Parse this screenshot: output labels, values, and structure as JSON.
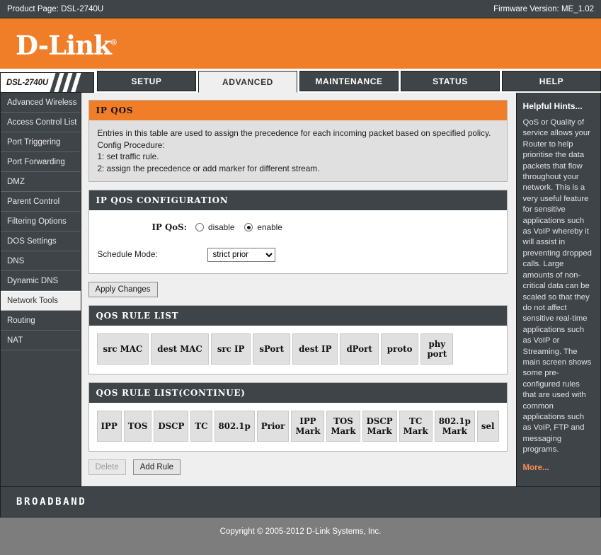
{
  "topbar": {
    "product_page": "Product Page: DSL-2740U",
    "firmware": "Firmware Version: ME_1.02"
  },
  "brand": {
    "logo": "D-Link",
    "registered": "®"
  },
  "model_tab": {
    "label": "DSL-2740U"
  },
  "tabs": [
    {
      "label": "SETUP",
      "active": false
    },
    {
      "label": "ADVANCED",
      "active": true
    },
    {
      "label": "MAINTENANCE",
      "active": false
    },
    {
      "label": "STATUS",
      "active": false
    },
    {
      "label": "HELP",
      "active": false
    }
  ],
  "sidebar": {
    "items": [
      {
        "label": "Advanced Wireless",
        "active": false
      },
      {
        "label": "Access Control List",
        "active": false
      },
      {
        "label": "Port Triggering",
        "active": false
      },
      {
        "label": "Port Forwarding",
        "active": false
      },
      {
        "label": "DMZ",
        "active": false
      },
      {
        "label": "Parent Control",
        "active": false
      },
      {
        "label": "Filtering Options",
        "active": false
      },
      {
        "label": "DOS Settings",
        "active": false
      },
      {
        "label": "DNS",
        "active": false
      },
      {
        "label": "Dynamic DNS",
        "active": false
      },
      {
        "label": "Network Tools",
        "active": true
      },
      {
        "label": "Routing",
        "active": false
      },
      {
        "label": "NAT",
        "active": false
      }
    ]
  },
  "ip_qos": {
    "title": "IP QOS",
    "description_lines": [
      "Entries in this table are used to assign the precedence for each incoming packet based on specified policy.",
      "Config Procedure:",
      "1: set traffic rule.",
      "2: assign the precedence or add marker for different stream."
    ]
  },
  "config": {
    "title": "IP QOS CONFIGURATION",
    "ipqos_label": "IP QoS:",
    "disable_label": "disable",
    "enable_label": "enable",
    "selected": "enable",
    "schedule_label": "Schedule Mode:",
    "schedule_value": "strict prior",
    "schedule_options": [
      "strict prior"
    ],
    "apply_label": "Apply Changes"
  },
  "rule_list": {
    "title": "QOS RULE LIST",
    "headers": [
      "src MAC",
      "dest MAC",
      "src IP",
      "sPort",
      "dest IP",
      "dPort",
      "proto",
      "phy\nport"
    ],
    "rows": []
  },
  "rule_list_continue": {
    "title": "QOS RULE LIST(CONTINUE)",
    "headers": [
      "IPP",
      "TOS",
      "DSCP",
      "TC",
      "802.1p",
      "Prior",
      "IPP\nMark",
      "TOS\nMark",
      "DSCP\nMark",
      "TC\nMark",
      "802.1p\nMark",
      "sel"
    ],
    "rows": []
  },
  "actions": {
    "delete_label": "Delete",
    "delete_disabled": true,
    "add_rule_label": "Add Rule"
  },
  "hints": {
    "title": "Helpful Hints...",
    "body": "QoS or Quality of service allows your Router to help prioritise the data packets that flow throughout your network. This is a very useful feature for sensitive applications such as VoIP whereby it will assist in preventing dropped calls. Large amounts of non-critical data can be scaled so that they do not affect sensitive real-time applications such as VoIP or Streaming. The main screen shows some pre-configured rules that are used with common applications such as VoIP, FTP and messaging programs.",
    "more_label": "More..."
  },
  "footer": {
    "broadband": "BROADBAND",
    "copyright": "Copyright © 2005-2012 D-Link Systems, Inc."
  },
  "colors": {
    "orange": "#f07d28",
    "dark": "#3f4448",
    "panel_gray": "#e0e0e0",
    "page_gray": "#7d7d7d"
  }
}
